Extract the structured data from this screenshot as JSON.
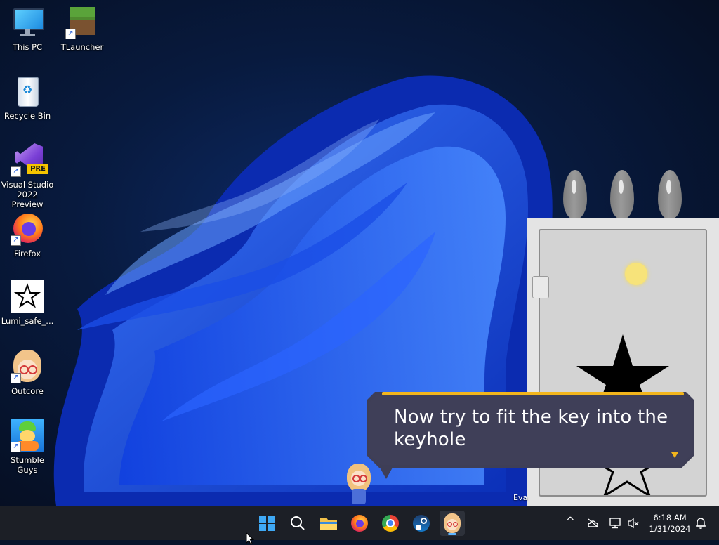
{
  "desktop": {
    "icons": [
      {
        "label": "This PC",
        "icon": "computer-icon"
      },
      {
        "label": "TLauncher",
        "icon": "grass-block-icon"
      },
      {
        "label": "Recycle Bin",
        "icon": "recycle-bin-icon"
      },
      {
        "label": "Visual Studio 2022 Preview",
        "icon": "visual-studio-icon",
        "badge": "PRE"
      },
      {
        "label": "Firefox",
        "icon": "firefox-icon"
      },
      {
        "label": "Lumi_safe_...",
        "icon": "star-icon"
      },
      {
        "label": "Outcore",
        "icon": "character-icon"
      },
      {
        "label": "Stumble Guys",
        "icon": "stumble-guys-icon"
      }
    ]
  },
  "dialog": {
    "text": "Now try to fit the key into the keyhole",
    "speaker_label": "Eva"
  },
  "taskbar": {
    "apps": [
      "start",
      "search",
      "file-explorer",
      "firefox",
      "chrome",
      "steam",
      "outcore"
    ],
    "clock": {
      "time": "6:18 AM",
      "date": "1/31/2024"
    },
    "tray_chevron": "^"
  },
  "colors": {
    "accent": "#f2b51c",
    "dialog_bg": "#3e3e56",
    "taskbar_bg": "#1c1f26",
    "wallpaper_blue": "#1f5cff"
  }
}
